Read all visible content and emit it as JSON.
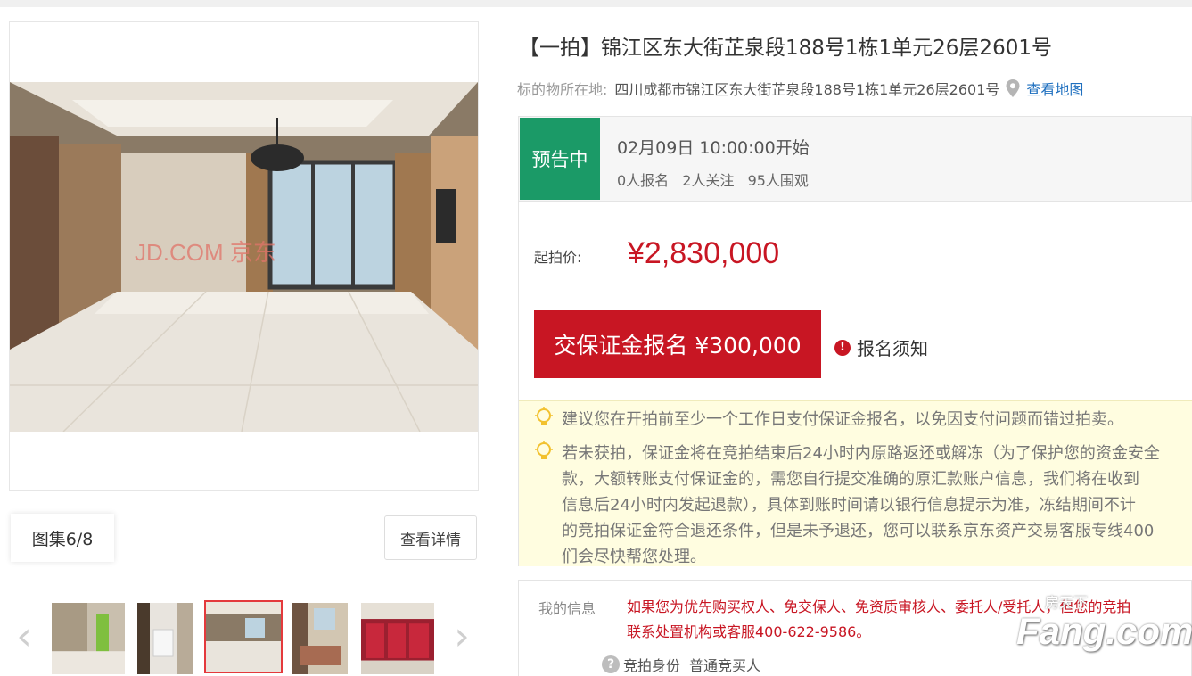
{
  "gallery": {
    "counter": "图集6/8",
    "detail_button": "查看详情",
    "prev_icon": "chevron-left-icon",
    "next_icon": "chevron-right-icon",
    "thumbnails": [
      "thumbnail-1",
      "thumbnail-2",
      "thumbnail-3",
      "thumbnail-4",
      "thumbnail-5"
    ],
    "active_thumbnail": 3,
    "photo_watermark": "JD.COM 京东"
  },
  "listing": {
    "title": "【一拍】锦江区东大街芷泉段188号1栋1单元26层2601号",
    "address_label": "标的物所在地:",
    "address_value": "四川成都市锦江区东大街芷泉段188号1栋1单元26层2601号",
    "map_link": "查看地图"
  },
  "status": {
    "badge": "预告中",
    "start_time": "02月09日 10:00:00开始",
    "signups": "0人报名",
    "follows": "2人关注",
    "views": "95人围观"
  },
  "price": {
    "label": "起拍价:",
    "value": "¥2,830,000",
    "deposit_button": "交保证金报名 ¥300,000",
    "notice_link": "报名须知"
  },
  "tips": [
    "建议您在开拍前至少一个工作日支付保证金报名，以免因支付问题而错过拍卖。",
    "若未获拍，保证金将在竞拍结束后24小时内原路返还或解冻（为了保护您的资金安全\n款，大额转账支付保证金的，需您自行提交准确的原汇款账户信息，我们将在收到\n信息后24小时内发起退款），具体到账时间请以银行信息提示为准，冻结期间不计\n的竞拍保证金符合退还条件，但是未予退还，您可以联系京东资产交易客服专线400\n们会尽快帮您处理。"
  ],
  "my_info": {
    "label": "我的信息",
    "text": "如果您为优先购买权人、免交保人、免资质审核人、委托人/受托人，但您的竞拍\n联系处置机构或客服400-622-9586。",
    "identity_label": "竞拍身份",
    "identity_value": "普通竞买人"
  },
  "watermark": {
    "small": "房天下",
    "big": "Fang.com"
  },
  "colors": {
    "accent_red": "#c81623",
    "status_green": "#1b9a67",
    "link_blue": "#1e6fbf",
    "tip_background": "#fffde0"
  }
}
